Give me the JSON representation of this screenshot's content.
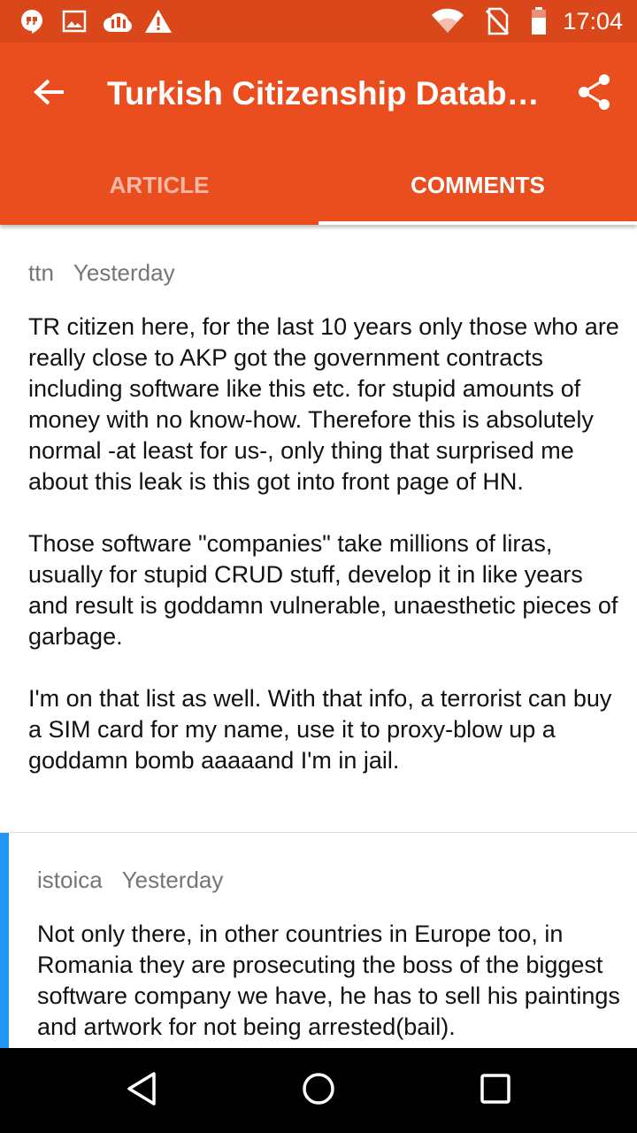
{
  "status_bar": {
    "time": "17:04",
    "icons": [
      "hangouts-icon",
      "image-icon",
      "cloud-upload-icon",
      "warning-icon",
      "wifi-icon",
      "no-sim-icon",
      "battery-icon"
    ]
  },
  "toolbar": {
    "title": "Turkish Citizenship Database Leak",
    "back_icon": "arrow-back-icon",
    "share_icon": "share-icon",
    "color": "#ea4e1f"
  },
  "tabs": [
    {
      "label": "ARTICLE",
      "selected": false
    },
    {
      "label": "COMMENTS",
      "selected": true
    }
  ],
  "comments": [
    {
      "author": "ttn",
      "time": "Yesterday",
      "paragraphs": [
        "TR citizen here, for the last 10 years only those who are really close to AKP got the government contracts including software like this etc. for stupid amounts of money with no know-how. Therefore this is absolutely normal -at least for us-, only thing that surprised me about this leak is this got into front page of HN.",
        "Those software \"companies\" take millions of liras, usually for stupid CRUD stuff, develop it in like years and result is goddamn vulnerable, unaesthetic pieces of garbage.",
        "I'm on that list as well. With that info, a terrorist can buy a SIM card for my name, use it to proxy-blow up a goddamn bomb aaaaand I'm in jail."
      ]
    },
    {
      "author": "istoica",
      "time": "Yesterday",
      "thread_color": "#2196f3",
      "paragraphs": [
        "Not only there, in other countries in Europe too, in Romania they are prosecuting the boss of the biggest software company we have, he has to sell his paintings and artwork for not being arrested(bail)."
      ]
    }
  ],
  "nav_bar": {
    "buttons": [
      "back-triangle-icon",
      "home-circle-icon",
      "recents-square-icon"
    ]
  }
}
